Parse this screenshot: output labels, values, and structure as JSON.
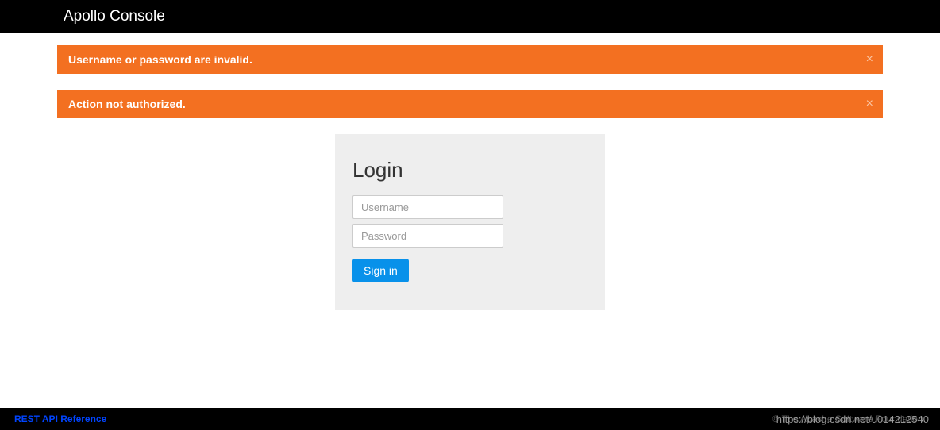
{
  "navbar": {
    "brand": "Apollo Console"
  },
  "alerts": [
    {
      "message": "Username or password are invalid.",
      "close_label": "×"
    },
    {
      "message": "Action not authorized.",
      "close_label": "×"
    }
  ],
  "login": {
    "title": "Login",
    "username_placeholder": "Username",
    "username_value": "",
    "password_placeholder": "Password",
    "password_value": "",
    "signin_label": "Sign in"
  },
  "footer": {
    "rest_api_link": "REST API Reference",
    "copyright": "© The Apache Software Foundation."
  },
  "watermark": "https://blog.csdn.net/u014212540"
}
